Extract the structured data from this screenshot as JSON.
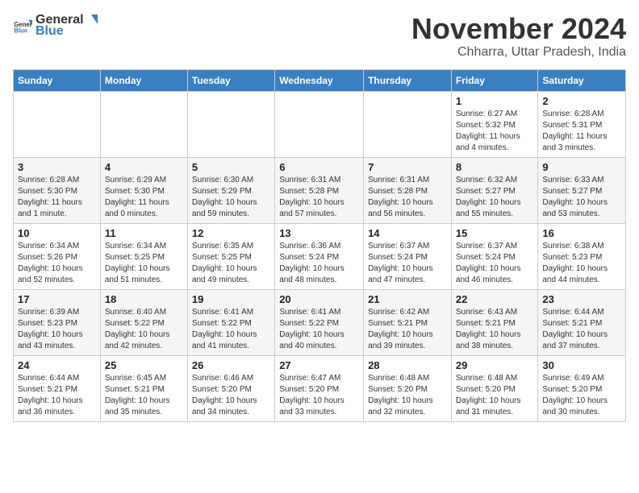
{
  "header": {
    "logo_general": "General",
    "logo_blue": "Blue",
    "month_title": "November 2024",
    "location": "Chharra, Uttar Pradesh, India"
  },
  "weekdays": [
    "Sunday",
    "Monday",
    "Tuesday",
    "Wednesday",
    "Thursday",
    "Friday",
    "Saturday"
  ],
  "weeks": [
    [
      {
        "day": "",
        "info": ""
      },
      {
        "day": "",
        "info": ""
      },
      {
        "day": "",
        "info": ""
      },
      {
        "day": "",
        "info": ""
      },
      {
        "day": "",
        "info": ""
      },
      {
        "day": "1",
        "info": "Sunrise: 6:27 AM\nSunset: 5:32 PM\nDaylight: 11 hours\nand 4 minutes."
      },
      {
        "day": "2",
        "info": "Sunrise: 6:28 AM\nSunset: 5:31 PM\nDaylight: 11 hours\nand 3 minutes."
      }
    ],
    [
      {
        "day": "3",
        "info": "Sunrise: 6:28 AM\nSunset: 5:30 PM\nDaylight: 11 hours\nand 1 minute."
      },
      {
        "day": "4",
        "info": "Sunrise: 6:29 AM\nSunset: 5:30 PM\nDaylight: 11 hours\nand 0 minutes."
      },
      {
        "day": "5",
        "info": "Sunrise: 6:30 AM\nSunset: 5:29 PM\nDaylight: 10 hours\nand 59 minutes."
      },
      {
        "day": "6",
        "info": "Sunrise: 6:31 AM\nSunset: 5:28 PM\nDaylight: 10 hours\nand 57 minutes."
      },
      {
        "day": "7",
        "info": "Sunrise: 6:31 AM\nSunset: 5:28 PM\nDaylight: 10 hours\nand 56 minutes."
      },
      {
        "day": "8",
        "info": "Sunrise: 6:32 AM\nSunset: 5:27 PM\nDaylight: 10 hours\nand 55 minutes."
      },
      {
        "day": "9",
        "info": "Sunrise: 6:33 AM\nSunset: 5:27 PM\nDaylight: 10 hours\nand 53 minutes."
      }
    ],
    [
      {
        "day": "10",
        "info": "Sunrise: 6:34 AM\nSunset: 5:26 PM\nDaylight: 10 hours\nand 52 minutes."
      },
      {
        "day": "11",
        "info": "Sunrise: 6:34 AM\nSunset: 5:25 PM\nDaylight: 10 hours\nand 51 minutes."
      },
      {
        "day": "12",
        "info": "Sunrise: 6:35 AM\nSunset: 5:25 PM\nDaylight: 10 hours\nand 49 minutes."
      },
      {
        "day": "13",
        "info": "Sunrise: 6:36 AM\nSunset: 5:24 PM\nDaylight: 10 hours\nand 48 minutes."
      },
      {
        "day": "14",
        "info": "Sunrise: 6:37 AM\nSunset: 5:24 PM\nDaylight: 10 hours\nand 47 minutes."
      },
      {
        "day": "15",
        "info": "Sunrise: 6:37 AM\nSunset: 5:24 PM\nDaylight: 10 hours\nand 46 minutes."
      },
      {
        "day": "16",
        "info": "Sunrise: 6:38 AM\nSunset: 5:23 PM\nDaylight: 10 hours\nand 44 minutes."
      }
    ],
    [
      {
        "day": "17",
        "info": "Sunrise: 6:39 AM\nSunset: 5:23 PM\nDaylight: 10 hours\nand 43 minutes."
      },
      {
        "day": "18",
        "info": "Sunrise: 6:40 AM\nSunset: 5:22 PM\nDaylight: 10 hours\nand 42 minutes."
      },
      {
        "day": "19",
        "info": "Sunrise: 6:41 AM\nSunset: 5:22 PM\nDaylight: 10 hours\nand 41 minutes."
      },
      {
        "day": "20",
        "info": "Sunrise: 6:41 AM\nSunset: 5:22 PM\nDaylight: 10 hours\nand 40 minutes."
      },
      {
        "day": "21",
        "info": "Sunrise: 6:42 AM\nSunset: 5:21 PM\nDaylight: 10 hours\nand 39 minutes."
      },
      {
        "day": "22",
        "info": "Sunrise: 6:43 AM\nSunset: 5:21 PM\nDaylight: 10 hours\nand 38 minutes."
      },
      {
        "day": "23",
        "info": "Sunrise: 6:44 AM\nSunset: 5:21 PM\nDaylight: 10 hours\nand 37 minutes."
      }
    ],
    [
      {
        "day": "24",
        "info": "Sunrise: 6:44 AM\nSunset: 5:21 PM\nDaylight: 10 hours\nand 36 minutes."
      },
      {
        "day": "25",
        "info": "Sunrise: 6:45 AM\nSunset: 5:21 PM\nDaylight: 10 hours\nand 35 minutes."
      },
      {
        "day": "26",
        "info": "Sunrise: 6:46 AM\nSunset: 5:20 PM\nDaylight: 10 hours\nand 34 minutes."
      },
      {
        "day": "27",
        "info": "Sunrise: 6:47 AM\nSunset: 5:20 PM\nDaylight: 10 hours\nand 33 minutes."
      },
      {
        "day": "28",
        "info": "Sunrise: 6:48 AM\nSunset: 5:20 PM\nDaylight: 10 hours\nand 32 minutes."
      },
      {
        "day": "29",
        "info": "Sunrise: 6:48 AM\nSunset: 5:20 PM\nDaylight: 10 hours\nand 31 minutes."
      },
      {
        "day": "30",
        "info": "Sunrise: 6:49 AM\nSunset: 5:20 PM\nDaylight: 10 hours\nand 30 minutes."
      }
    ]
  ]
}
